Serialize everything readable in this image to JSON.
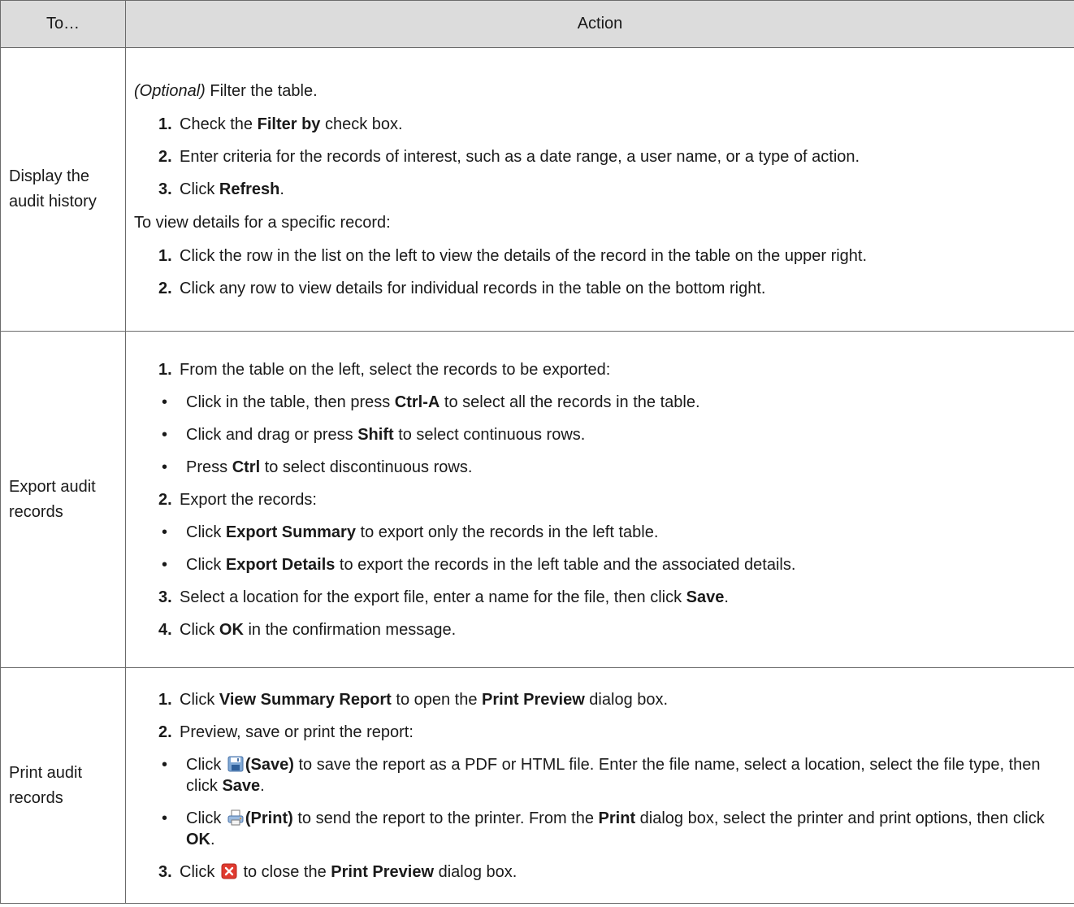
{
  "header": {
    "col1": "To…",
    "col2": "Action"
  },
  "rows": [
    {
      "label": "Display the audit history",
      "optional": "(Optional)",
      "filter_text": " Filter the table.",
      "filter_steps": [
        {
          "n": "1.",
          "a": "Check the ",
          "b": "Filter by",
          "c": " check box."
        },
        {
          "n": "2.",
          "a": "Enter criteria for the records of interest, such as a date range, a user name, or a type of action."
        },
        {
          "n": "3.",
          "a": "Click ",
          "b": "Refresh",
          "c": "."
        }
      ],
      "view_text": "To view details for a specific record:",
      "view_steps": [
        {
          "n": "1.",
          "a": "Click the row in the list on the left to view the details of the record in the table on the upper right."
        },
        {
          "n": "2.",
          "a": "Click any row to view details for individual records in the table on the bottom right."
        }
      ]
    },
    {
      "label": "Export audit records",
      "s1": {
        "n": "1.",
        "a": "From the table on the left, select the records to be exported:"
      },
      "s1_bullets": [
        {
          "a": "Click in the table, then press ",
          "b": "Ctrl-A",
          "c": " to select all the records in the table."
        },
        {
          "a": "Click and drag or press ",
          "b": "Shift",
          "c": " to select continuous rows."
        },
        {
          "a": "Press ",
          "b": "Ctrl",
          "c": " to select discontinuous rows."
        }
      ],
      "s2": {
        "n": "2.",
        "a": "Export the records:"
      },
      "s2_bullets": [
        {
          "a": "Click ",
          "b": "Export Summary",
          "c": " to export only the records in the left table."
        },
        {
          "a": "Click ",
          "b": "Export Details",
          "c": " to export the records in the left table and the associated details."
        }
      ],
      "s3": {
        "n": "3.",
        "a": "Select a location for the export file, enter a name for the file, then click ",
        "b": "Save",
        "c": "."
      },
      "s4": {
        "n": "4.",
        "a": "Click ",
        "b": "OK",
        "c": " in the confirmation message."
      }
    },
    {
      "label": "Print audit records",
      "s1": {
        "n": "1.",
        "a": "Click ",
        "b": "View Summary Report",
        "c": " to open the ",
        "d": "Print Preview",
        "e": " dialog box."
      },
      "s2": {
        "n": "2.",
        "a": "Preview, save or print the report:"
      },
      "bullet_save": {
        "a": "Click ",
        "b": "(Save)",
        "c": " to save the report as a PDF or HTML file. Enter the file name, select a location, select the file type, then click ",
        "d": "Save",
        "e": "."
      },
      "bullet_print": {
        "a": "Click ",
        "b": "(Print)",
        "c": " to send the report to the printer. From the ",
        "d": "Print",
        "e": " dialog box, select the printer and print options, then click ",
        "f": "OK",
        "g": "."
      },
      "s3": {
        "n": "3.",
        "a": "Click ",
        "c": " to close the ",
        "d": "Print Preview",
        "e": " dialog box."
      }
    }
  ],
  "icons": {
    "save": "save-icon",
    "print": "print-icon",
    "close": "close-icon"
  },
  "colors": {
    "header_bg": "#dcdcdc",
    "border": "#6b6b6b",
    "close_red": "#e03a2f"
  }
}
